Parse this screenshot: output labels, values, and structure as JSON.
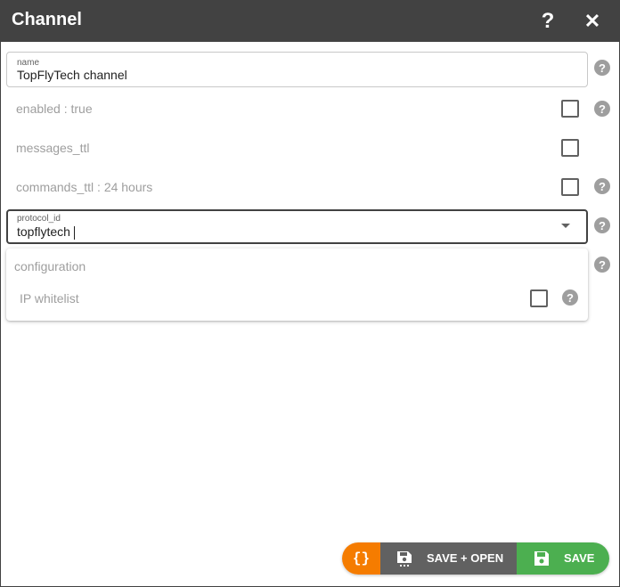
{
  "window": {
    "title": "Channel",
    "help_glyph": "?",
    "close_glyph": "✕"
  },
  "form": {
    "name": {
      "label": "name",
      "value": "TopFlyTech channel"
    },
    "enabled": {
      "label": "enabled : true",
      "checked": false
    },
    "messages_ttl": {
      "label": "messages_ttl",
      "checked": false
    },
    "commands_ttl": {
      "label": "commands_ttl : 24 hours",
      "checked": false
    },
    "protocol_id": {
      "label": "protocol_id",
      "value": "topflytech"
    },
    "configuration": {
      "title": "configuration",
      "ip_whitelist": {
        "label": "IP whitelist",
        "checked": false
      }
    }
  },
  "help_icon": {
    "glyph": "?"
  },
  "actions": {
    "json_label": "{}",
    "save_open_label": "SAVE + OPEN",
    "save_label": "SAVE"
  },
  "colors": {
    "titlebar": "#424242",
    "json_button": "#f57c00",
    "save_open_button": "#616161",
    "save_button": "#4caf50",
    "help_icon": "#9e9e9e"
  },
  "icons": {
    "title_help": "question-mark-icon",
    "title_close": "close-icon",
    "field_help": "help-circle-icon",
    "dropdown": "chevron-down-icon",
    "save": "floppy-disk-icon",
    "save_open": "floppy-disk-dots-icon"
  }
}
